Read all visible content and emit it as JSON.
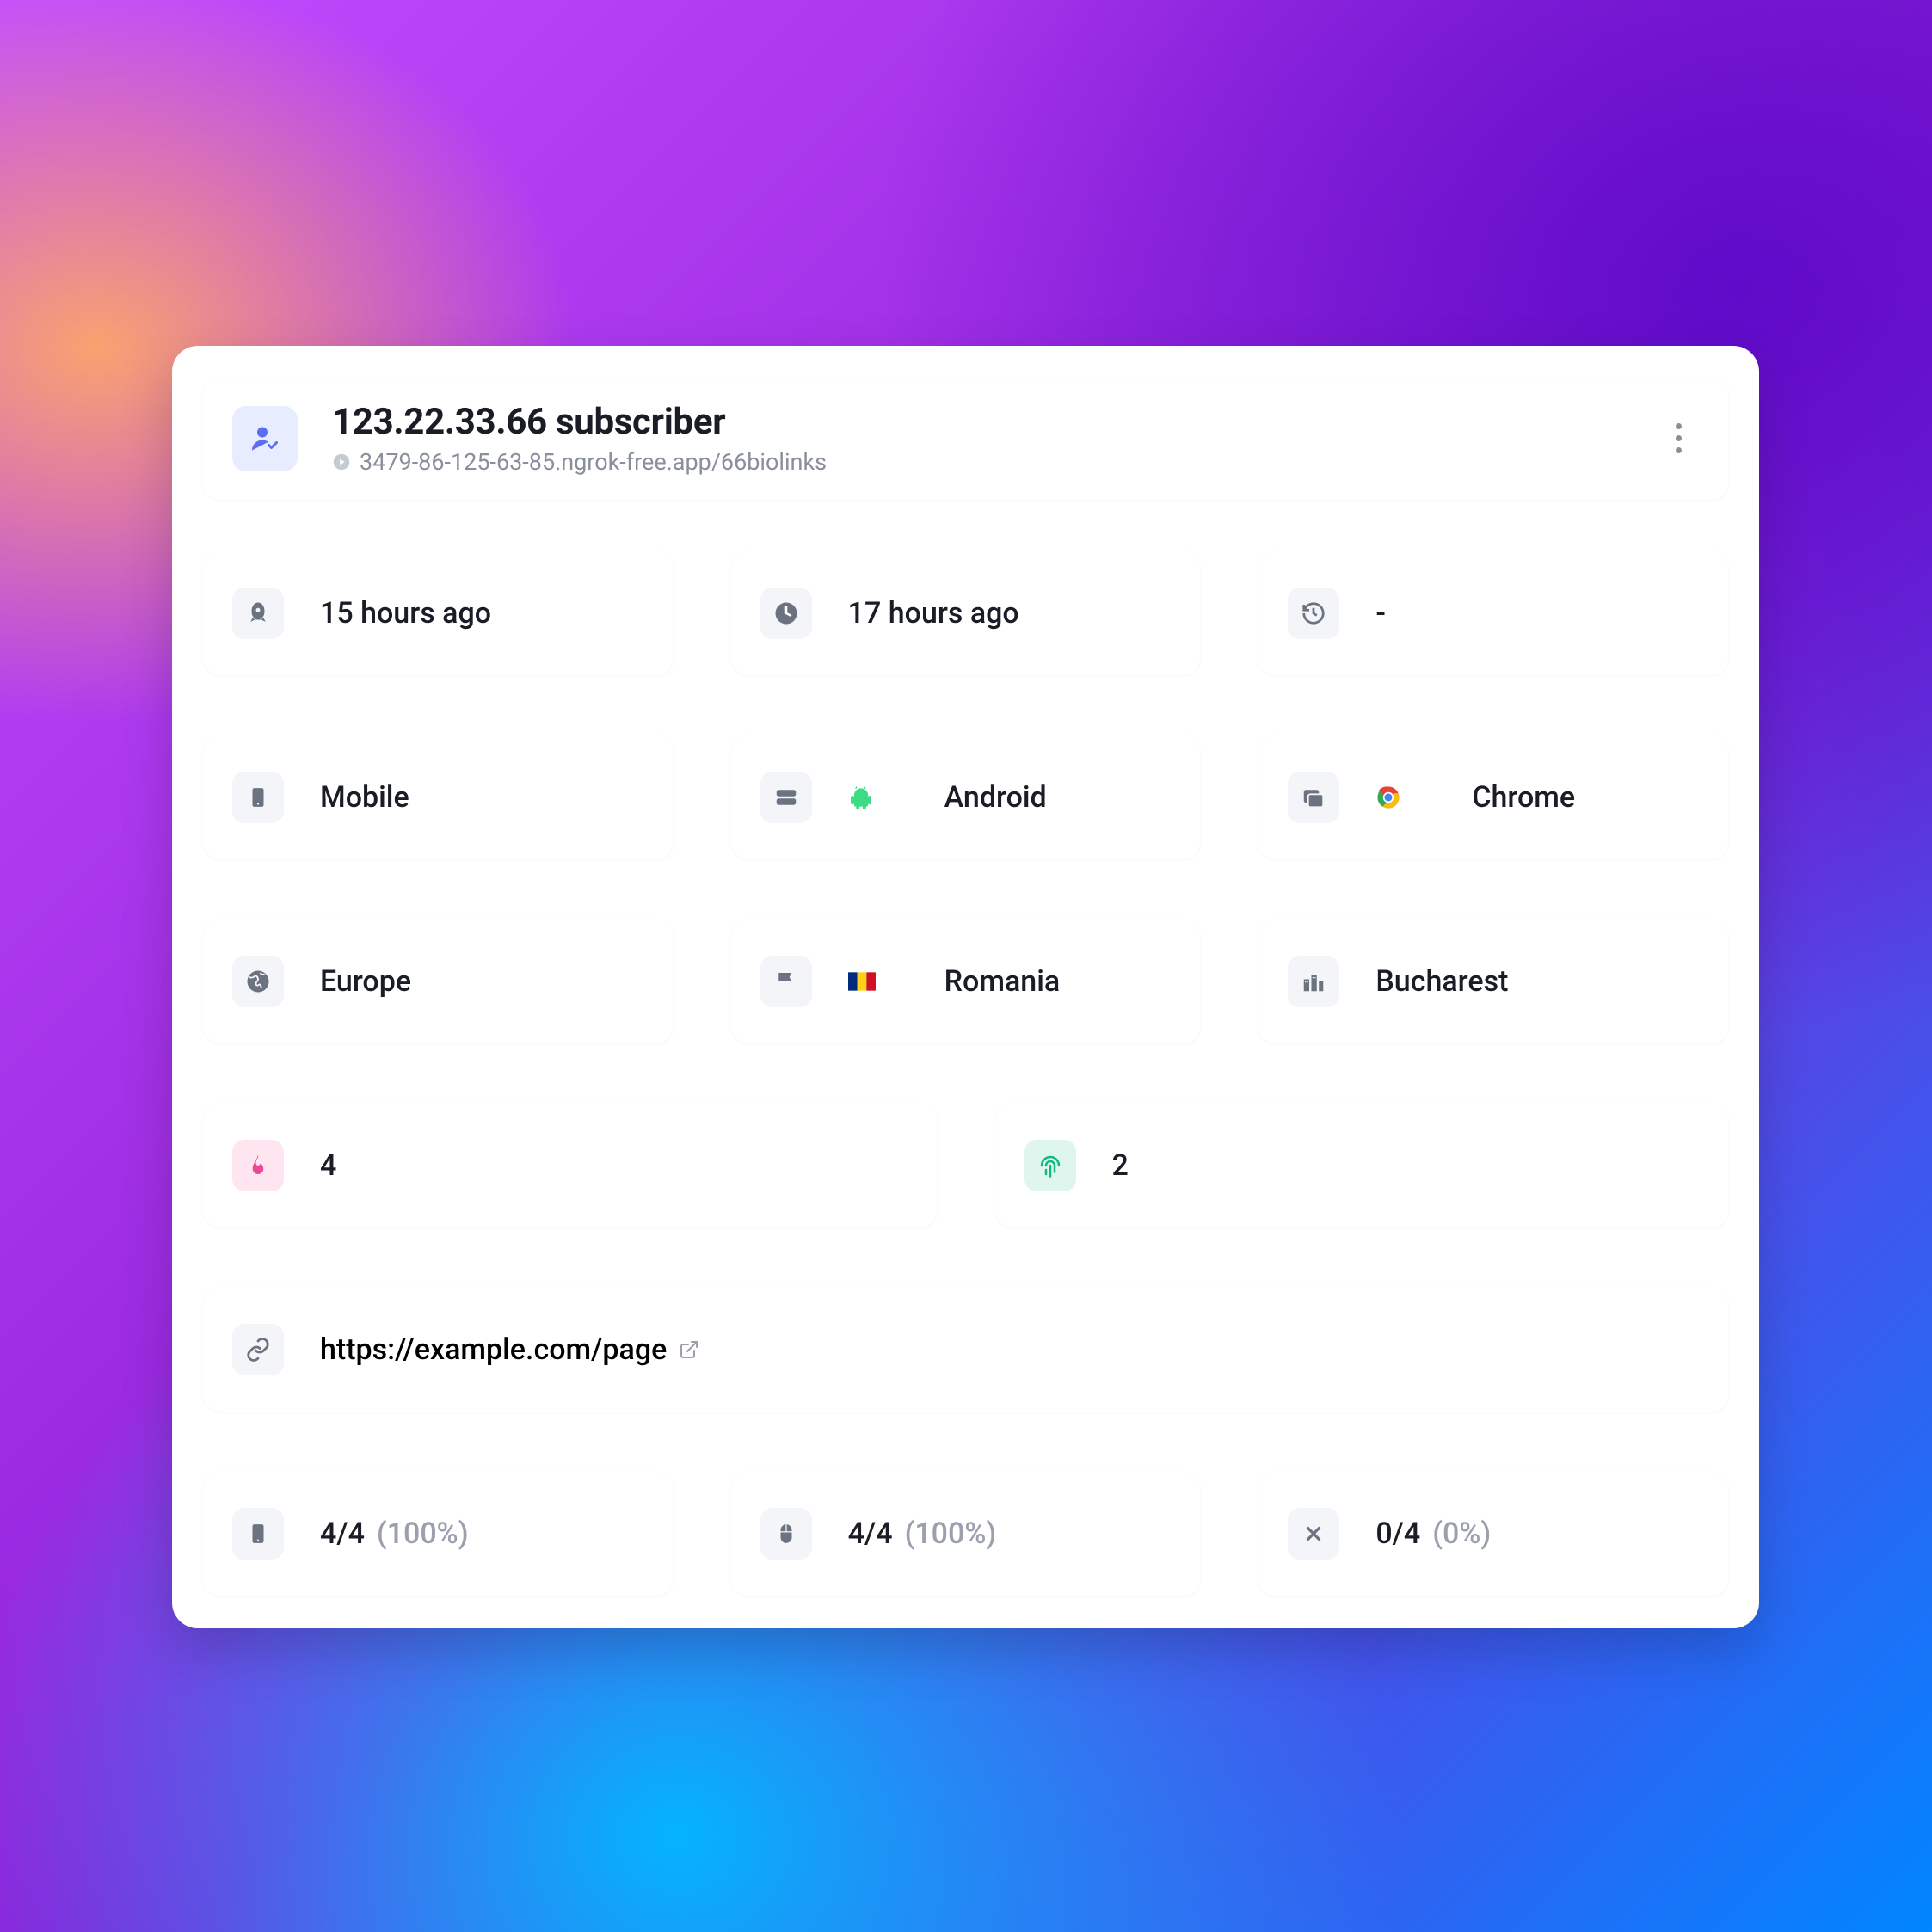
{
  "header": {
    "title": "123.22.33.66 subscriber",
    "subtitle": "3479-86-125-63-85.ngrok-free.app/66biolinks"
  },
  "row1": {
    "created": "15 hours ago",
    "lastSeen": "17 hours ago",
    "history": "-"
  },
  "row2": {
    "device": "Mobile",
    "os": "Android",
    "browser": "Chrome"
  },
  "row3": {
    "continent": "Europe",
    "country": "Romania",
    "city": "Bucharest"
  },
  "row4": {
    "hot": "4",
    "finger": "2"
  },
  "row5": {
    "url": "https://example.com/page"
  },
  "row6": {
    "a": {
      "frac": "4/4",
      "pct": "(100%)"
    },
    "b": {
      "frac": "4/4",
      "pct": "(100%)"
    },
    "c": {
      "frac": "0/4",
      "pct": "(0%)"
    }
  }
}
